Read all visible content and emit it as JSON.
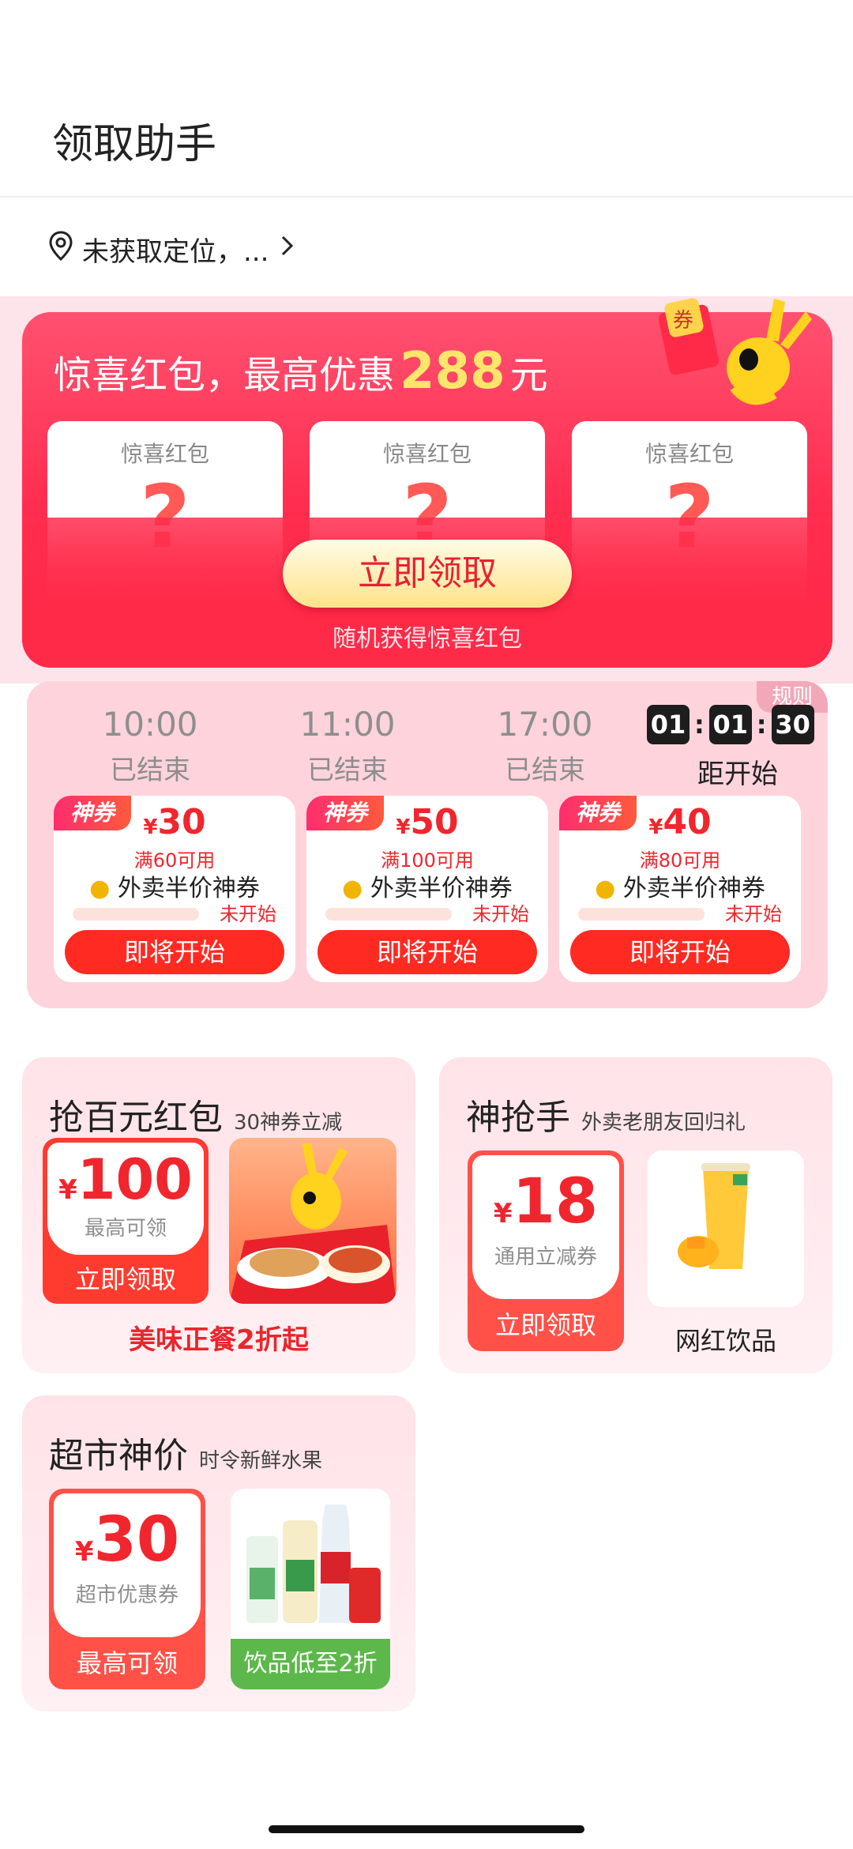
{
  "header": {
    "title": "领取助手"
  },
  "location": {
    "text": "未获取定位，...",
    "icon": "location-pin-icon"
  },
  "hero": {
    "title_prefix": "惊喜红包，最高优惠",
    "title_amount": "288",
    "title_unit": "元",
    "slots": [
      {
        "label": "惊喜红包",
        "mark": "?"
      },
      {
        "label": "惊喜红包",
        "mark": "?"
      },
      {
        "label": "惊喜红包",
        "mark": "?"
      }
    ],
    "button": "立即领取",
    "subtitle": "随机获得惊喜红包",
    "mascot_badge": "券"
  },
  "flash_sale": {
    "rule": "规则",
    "slots": [
      {
        "time": "10:00",
        "status": "已结束"
      },
      {
        "time": "11:00",
        "status": "已结束"
      },
      {
        "time": "17:00",
        "status": "已结束"
      }
    ],
    "countdown": {
      "h": "01",
      "m": "01",
      "s": "30",
      "label": "距开始"
    },
    "coupons": [
      {
        "tag": "神券",
        "currency": "¥",
        "amount": "30",
        "condition": "满60可用",
        "name": "外卖半价神券",
        "state": "未开始",
        "button": "即将开始"
      },
      {
        "tag": "神券",
        "currency": "¥",
        "amount": "50",
        "condition": "满100可用",
        "name": "外卖半价神券",
        "state": "未开始",
        "button": "即将开始"
      },
      {
        "tag": "神券",
        "currency": "¥",
        "amount": "40",
        "condition": "满80可用",
        "name": "外卖半价神券",
        "state": "未开始",
        "button": "即将开始"
      }
    ]
  },
  "cards": {
    "hongbao": {
      "title": "抢百元红包",
      "subtitle": "30神券立减",
      "currency": "¥",
      "amount": "100",
      "caption": "最高可领",
      "button": "立即领取",
      "footer": "美味正餐2折起"
    },
    "shenqiang": {
      "title": "神抢手",
      "subtitle": "外卖老朋友回归礼",
      "currency": "¥",
      "amount": "18",
      "caption": "通用立减券",
      "button": "立即领取",
      "product": "网红饮品"
    },
    "supermarket": {
      "title": "超市神价",
      "subtitle": "时令新鲜水果",
      "currency": "¥",
      "amount": "30",
      "caption": "超市优惠券",
      "button": "最高可领",
      "promo": "饮品低至2折"
    }
  },
  "colors": {
    "primary_red": "#ff2a22",
    "panel_pink": "#ffd3dc",
    "gold": "#ffe66a"
  }
}
